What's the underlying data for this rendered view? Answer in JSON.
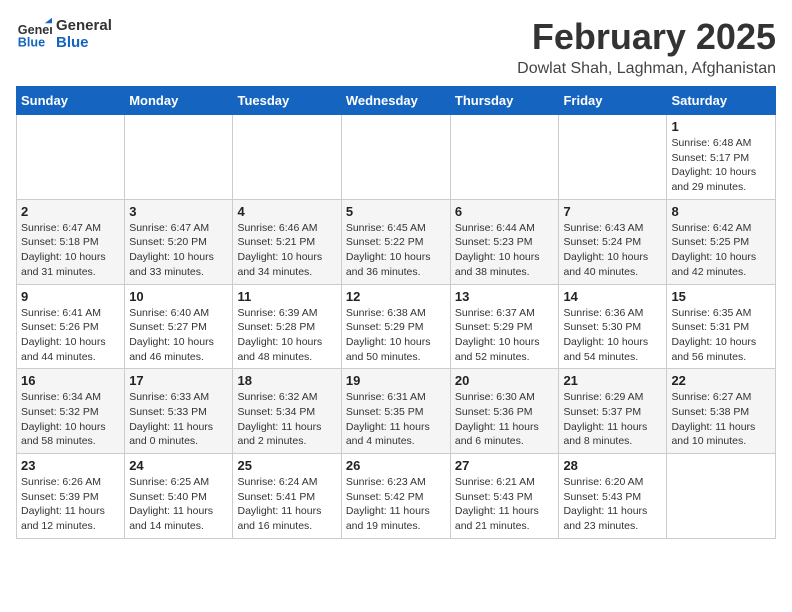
{
  "header": {
    "logo_line1": "General",
    "logo_line2": "Blue",
    "month_title": "February 2025",
    "location": "Dowlat Shah, Laghman, Afghanistan"
  },
  "days_of_week": [
    "Sunday",
    "Monday",
    "Tuesday",
    "Wednesday",
    "Thursday",
    "Friday",
    "Saturday"
  ],
  "weeks": [
    [
      {
        "day": "",
        "info": ""
      },
      {
        "day": "",
        "info": ""
      },
      {
        "day": "",
        "info": ""
      },
      {
        "day": "",
        "info": ""
      },
      {
        "day": "",
        "info": ""
      },
      {
        "day": "",
        "info": ""
      },
      {
        "day": "1",
        "info": "Sunrise: 6:48 AM\nSunset: 5:17 PM\nDaylight: 10 hours and 29 minutes."
      }
    ],
    [
      {
        "day": "2",
        "info": "Sunrise: 6:47 AM\nSunset: 5:18 PM\nDaylight: 10 hours and 31 minutes."
      },
      {
        "day": "3",
        "info": "Sunrise: 6:47 AM\nSunset: 5:20 PM\nDaylight: 10 hours and 33 minutes."
      },
      {
        "day": "4",
        "info": "Sunrise: 6:46 AM\nSunset: 5:21 PM\nDaylight: 10 hours and 34 minutes."
      },
      {
        "day": "5",
        "info": "Sunrise: 6:45 AM\nSunset: 5:22 PM\nDaylight: 10 hours and 36 minutes."
      },
      {
        "day": "6",
        "info": "Sunrise: 6:44 AM\nSunset: 5:23 PM\nDaylight: 10 hours and 38 minutes."
      },
      {
        "day": "7",
        "info": "Sunrise: 6:43 AM\nSunset: 5:24 PM\nDaylight: 10 hours and 40 minutes."
      },
      {
        "day": "8",
        "info": "Sunrise: 6:42 AM\nSunset: 5:25 PM\nDaylight: 10 hours and 42 minutes."
      }
    ],
    [
      {
        "day": "9",
        "info": "Sunrise: 6:41 AM\nSunset: 5:26 PM\nDaylight: 10 hours and 44 minutes."
      },
      {
        "day": "10",
        "info": "Sunrise: 6:40 AM\nSunset: 5:27 PM\nDaylight: 10 hours and 46 minutes."
      },
      {
        "day": "11",
        "info": "Sunrise: 6:39 AM\nSunset: 5:28 PM\nDaylight: 10 hours and 48 minutes."
      },
      {
        "day": "12",
        "info": "Sunrise: 6:38 AM\nSunset: 5:29 PM\nDaylight: 10 hours and 50 minutes."
      },
      {
        "day": "13",
        "info": "Sunrise: 6:37 AM\nSunset: 5:29 PM\nDaylight: 10 hours and 52 minutes."
      },
      {
        "day": "14",
        "info": "Sunrise: 6:36 AM\nSunset: 5:30 PM\nDaylight: 10 hours and 54 minutes."
      },
      {
        "day": "15",
        "info": "Sunrise: 6:35 AM\nSunset: 5:31 PM\nDaylight: 10 hours and 56 minutes."
      }
    ],
    [
      {
        "day": "16",
        "info": "Sunrise: 6:34 AM\nSunset: 5:32 PM\nDaylight: 10 hours and 58 minutes."
      },
      {
        "day": "17",
        "info": "Sunrise: 6:33 AM\nSunset: 5:33 PM\nDaylight: 11 hours and 0 minutes."
      },
      {
        "day": "18",
        "info": "Sunrise: 6:32 AM\nSunset: 5:34 PM\nDaylight: 11 hours and 2 minutes."
      },
      {
        "day": "19",
        "info": "Sunrise: 6:31 AM\nSunset: 5:35 PM\nDaylight: 11 hours and 4 minutes."
      },
      {
        "day": "20",
        "info": "Sunrise: 6:30 AM\nSunset: 5:36 PM\nDaylight: 11 hours and 6 minutes."
      },
      {
        "day": "21",
        "info": "Sunrise: 6:29 AM\nSunset: 5:37 PM\nDaylight: 11 hours and 8 minutes."
      },
      {
        "day": "22",
        "info": "Sunrise: 6:27 AM\nSunset: 5:38 PM\nDaylight: 11 hours and 10 minutes."
      }
    ],
    [
      {
        "day": "23",
        "info": "Sunrise: 6:26 AM\nSunset: 5:39 PM\nDaylight: 11 hours and 12 minutes."
      },
      {
        "day": "24",
        "info": "Sunrise: 6:25 AM\nSunset: 5:40 PM\nDaylight: 11 hours and 14 minutes."
      },
      {
        "day": "25",
        "info": "Sunrise: 6:24 AM\nSunset: 5:41 PM\nDaylight: 11 hours and 16 minutes."
      },
      {
        "day": "26",
        "info": "Sunrise: 6:23 AM\nSunset: 5:42 PM\nDaylight: 11 hours and 19 minutes."
      },
      {
        "day": "27",
        "info": "Sunrise: 6:21 AM\nSunset: 5:43 PM\nDaylight: 11 hours and 21 minutes."
      },
      {
        "day": "28",
        "info": "Sunrise: 6:20 AM\nSunset: 5:43 PM\nDaylight: 11 hours and 23 minutes."
      },
      {
        "day": "",
        "info": ""
      }
    ]
  ]
}
